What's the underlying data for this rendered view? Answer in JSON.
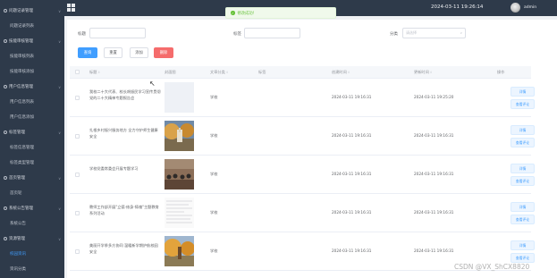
{
  "sidebar": {
    "items": [
      {
        "label": "问题记录管理",
        "type": "group"
      },
      {
        "label": "问题记录列表",
        "type": "sub"
      },
      {
        "label": "技能审核管理",
        "type": "group"
      },
      {
        "label": "技能审核列表",
        "type": "sub"
      },
      {
        "label": "技能审核添加",
        "type": "sub"
      },
      {
        "label": "用户信息管理",
        "type": "group"
      },
      {
        "label": "用户信息列表",
        "type": "sub"
      },
      {
        "label": "用户信息添加",
        "type": "sub"
      },
      {
        "label": "标签管理",
        "type": "group"
      },
      {
        "label": "标签信息管理",
        "type": "sub"
      },
      {
        "label": "标签类型管理",
        "type": "sub"
      },
      {
        "label": "首页管理",
        "type": "group"
      },
      {
        "label": "首页轮",
        "type": "sub"
      },
      {
        "label": "系统公告管理",
        "type": "group"
      },
      {
        "label": "系统公告",
        "type": "sub"
      },
      {
        "label": "资源管理",
        "type": "group"
      },
      {
        "label": "校园资讯",
        "type": "sub",
        "active": true
      },
      {
        "label": "资讯分类",
        "type": "sub"
      }
    ]
  },
  "topbar": {
    "datetime": "2024-03-11 19:26:14",
    "username": "admin"
  },
  "toast": {
    "message": "修改成功！"
  },
  "filters": {
    "title_label": "标题",
    "tag_label": "标签",
    "category_label": "分类",
    "category_placeholder": "请选择"
  },
  "actions": {
    "search": "查询",
    "reset": "重置",
    "add": "添加",
    "delete": "删除"
  },
  "table": {
    "headers": {
      "title": "标题",
      "cover": "封面图",
      "category": "文章分类",
      "tag": "标签",
      "created": "创建时间",
      "updated": "更新时间",
      "ops": "操作"
    },
    "rows": [
      {
        "title": "我校二十大代表、校长胡振民学习宣传贯彻党的二十大精神专题报告会",
        "category": "学校",
        "tag": "",
        "created": "2024-03-11 19:16:31",
        "updated": "2024-03-11 19:25:20",
        "cover": "blank"
      },
      {
        "title": "扎根乡村振兴服务地方 全力守护师生健康安全",
        "category": "学校",
        "tag": "",
        "created": "2024-03-11 19:16:31",
        "updated": "2024-03-11 19:16:31",
        "cover": "autumn"
      },
      {
        "title": "学校党委常委会开展专题学习",
        "category": "学校",
        "tag": "",
        "created": "2024-03-11 19:16:31",
        "updated": "2024-03-11 19:16:31",
        "cover": "meeting"
      },
      {
        "title": "教师工作部开展\"立德·修身·铸魂\"主题教育系列活动",
        "category": "学校",
        "tag": "",
        "created": "2024-03-11 19:16:31",
        "updated": "2024-03-11 19:16:31",
        "cover": "document"
      },
      {
        "title": "美丽开学季多方协同 温暖新学期护航校园安全",
        "category": "学校",
        "tag": "",
        "created": "2024-03-11 19:16:31",
        "updated": "2024-03-11 19:16:31",
        "cover": "autumn2"
      }
    ],
    "op_detail": "详情",
    "op_comment": "查看评论"
  },
  "watermark": "CSDN @VX_ShCX8820"
}
